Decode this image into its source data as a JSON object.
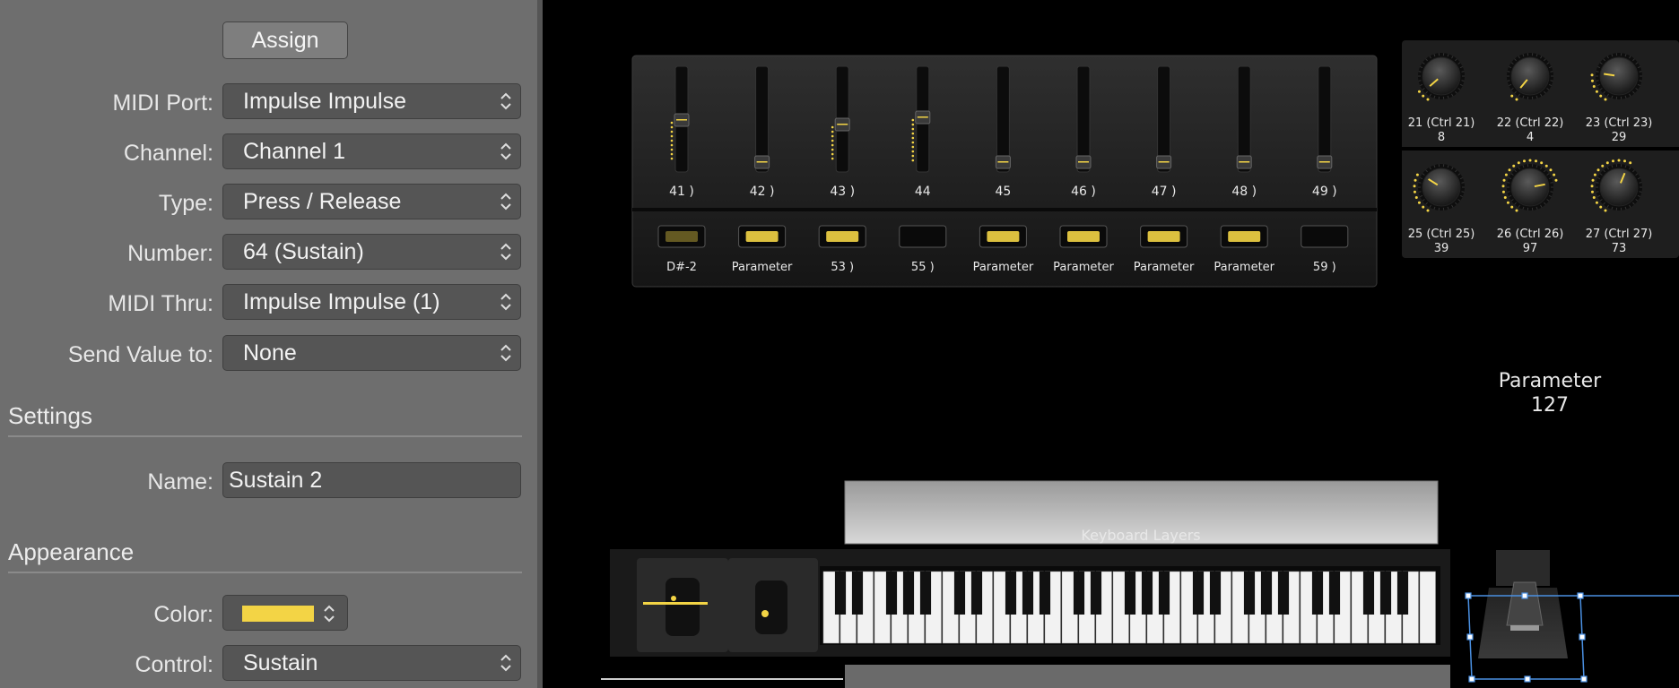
{
  "inspector": {
    "assign_label": "Assign",
    "fields": [
      {
        "label": "MIDI Port:",
        "value": "Impulse  Impulse"
      },
      {
        "label": "Channel:",
        "value": "Channel 1"
      },
      {
        "label": "Type:",
        "value": "Press / Release"
      },
      {
        "label": "Number:",
        "value": "64 (Sustain)"
      },
      {
        "label": "MIDI Thru:",
        "value": "Impulse  Impulse (1)"
      },
      {
        "label": "Send Value to:",
        "value": "None"
      }
    ],
    "settings_heading": "Settings",
    "name_label": "Name:",
    "name_value": "Sustain 2",
    "appearance_heading": "Appearance",
    "color_label": "Color:",
    "color_value": "#f3d445",
    "control_label": "Control:",
    "control_value": "Sustain"
  },
  "mixer": {
    "faders": [
      {
        "label": "41 )",
        "level": 0.47
      },
      {
        "label": "42 )",
        "level": 0.0
      },
      {
        "label": "43 )",
        "level": 0.42
      },
      {
        "label": "44",
        "level": 0.5
      },
      {
        "label": "45",
        "level": 0.0
      },
      {
        "label": "46 )",
        "level": 0.0
      },
      {
        "label": "47 )",
        "level": 0.0
      },
      {
        "label": "48 )",
        "level": 0.0
      },
      {
        "label": "49 )",
        "level": 0.0
      }
    ],
    "buttons": [
      {
        "label": "D#-2",
        "lit": "dim"
      },
      {
        "label": "Parameter",
        "lit": "on"
      },
      {
        "label": "53 )",
        "lit": "on"
      },
      {
        "label": "55 )",
        "lit": "off"
      },
      {
        "label": "Parameter",
        "lit": "on"
      },
      {
        "label": "Parameter",
        "lit": "on"
      },
      {
        "label": "Parameter",
        "lit": "on"
      },
      {
        "label": "Parameter",
        "lit": "on"
      },
      {
        "label": "59 )",
        "lit": "off"
      }
    ]
  },
  "knobs": [
    {
      "label": "21 (Ctrl 21)",
      "value": 8
    },
    {
      "label": "22 (Ctrl 22)",
      "value": 4
    },
    {
      "label": "23 (Ctrl 23)",
      "value": 29
    },
    {
      "label": "25 (Ctrl 25)",
      "value": 39
    },
    {
      "label": "26 (Ctrl 26)",
      "value": 97
    },
    {
      "label": "27 (Ctrl 27)",
      "value": 73
    }
  ],
  "readout": {
    "name": "Parameter",
    "value": "127"
  },
  "keyboard": {
    "layers_label": "Keyboard Layers"
  },
  "colors": {
    "accent": "#f3d445",
    "selection": "#4a90e2"
  }
}
